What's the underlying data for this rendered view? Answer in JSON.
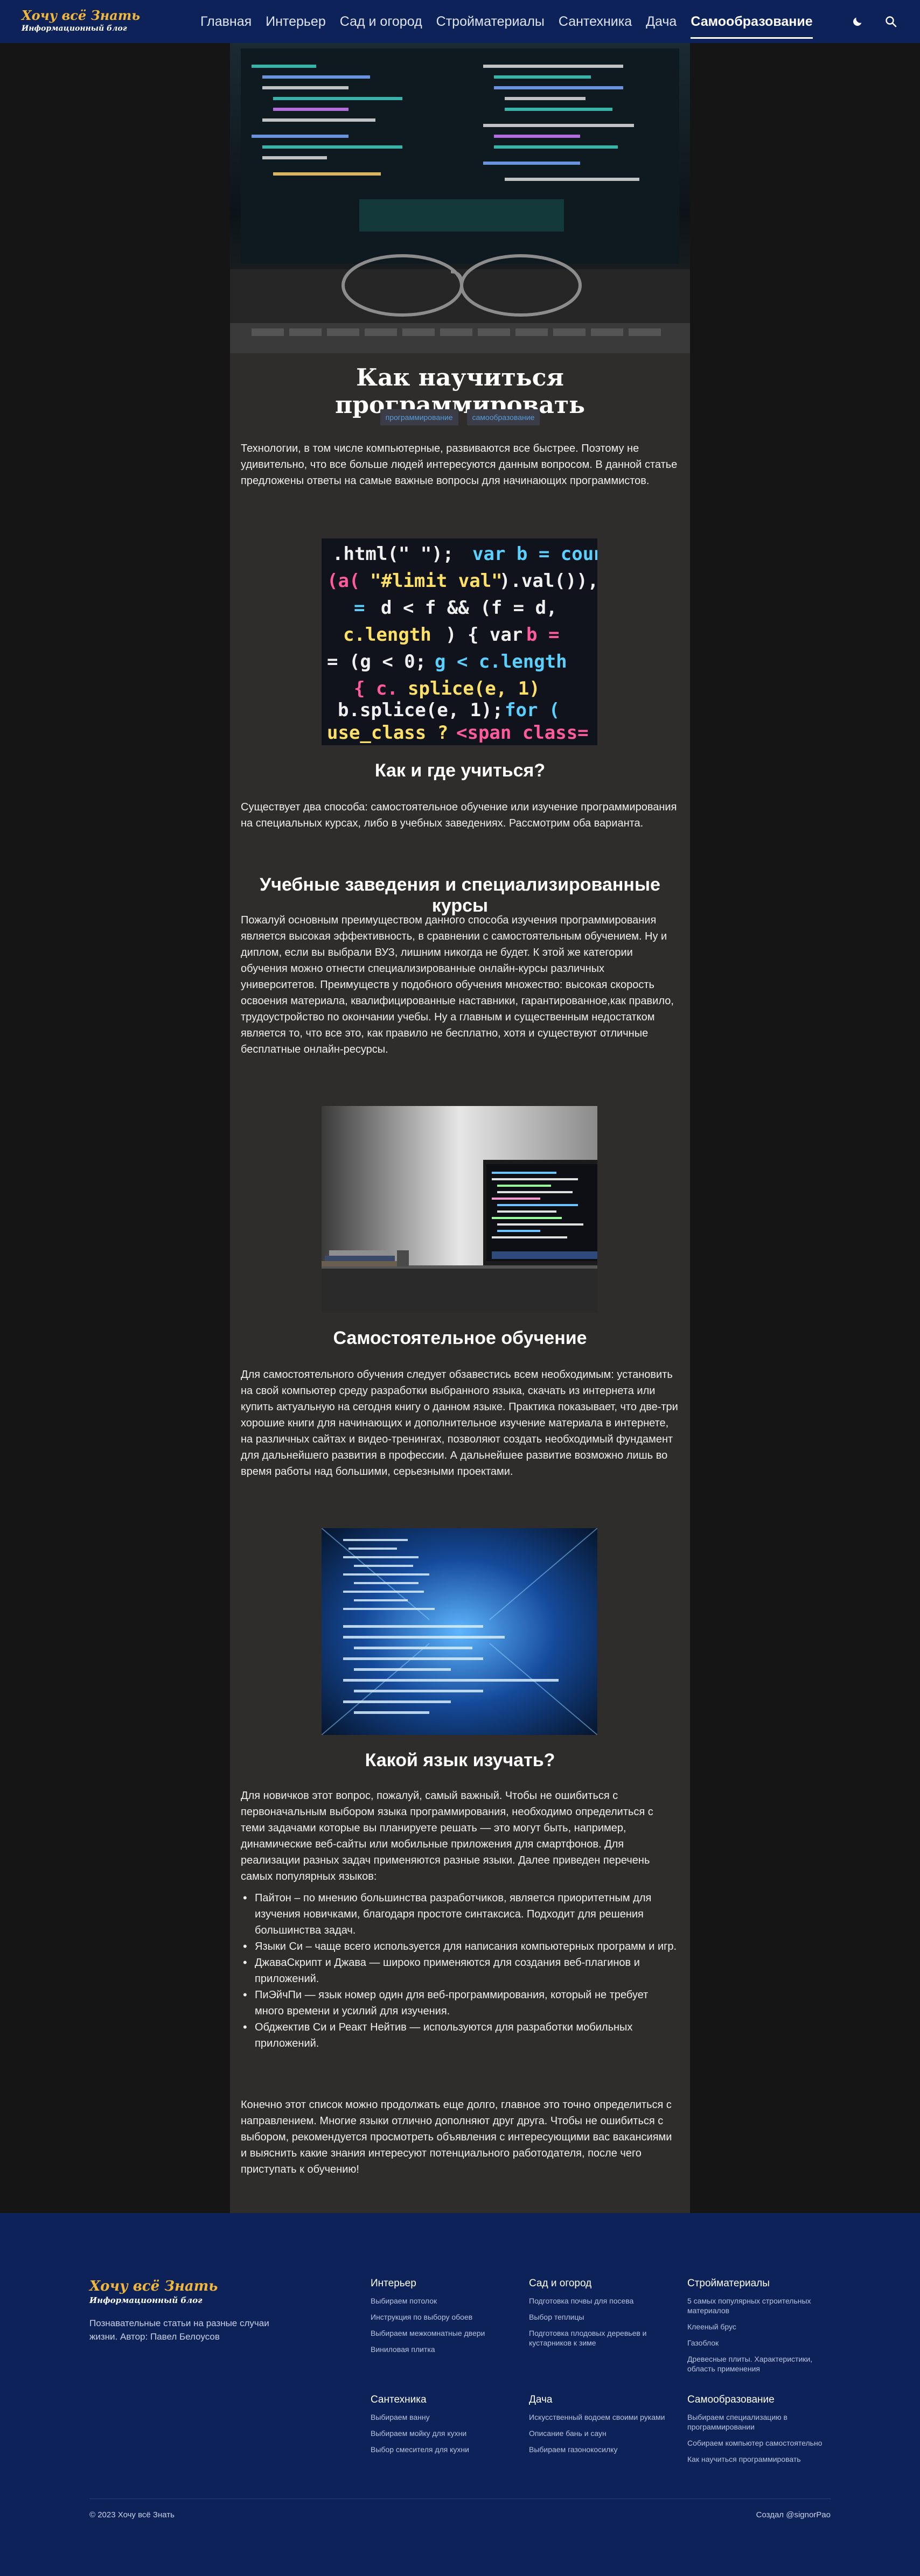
{
  "header": {
    "brand_title": "Хочу всё Знать",
    "brand_subtitle": "Информационный блог",
    "nav": [
      "Главная",
      "Интерьер",
      "Сад и огород",
      "Стройматериалы",
      "Сантехника",
      "Дача",
      "Самообразование"
    ],
    "active_nav_index": 6,
    "theme_icon": "moon-icon",
    "search_icon": "search-icon"
  },
  "article": {
    "title": "Как научиться программировать",
    "tags": [
      "программирование",
      "самообразование"
    ],
    "intro": "Технологии, в том числе компьютерные, развиваются все быстрее. Поэтому не удивительно, что все больше людей интересуются данным вопросом. В данной статье предложены ответы на самые важные вопросы для начинающих программистов.",
    "section1_title": "Как и где учиться?",
    "section1_text": "Существует два способа: самостоятельное обучение или изучение программирования на специальных курсах, либо в учебных заведениях. Рассмотрим оба варианта.",
    "section2_title": "Учебные заведения и специализированные курсы",
    "section2_text": "Пожалуй основным преимуществом данного способа изучения программирования является высокая эффективность, в сравнении с самостоятельным обучением. Ну и диплом, если вы выбрали ВУЗ, лишним никогда не будет. К этой же категории обучения можно отнести специализированные онлайн-курсы различных университетов. Преимуществ у подобного обучения множество: высокая скорость освоения материала, квалифицированные наставники, гарантированное,как правило, трудоустройство по окончании учебы. Ну а главным и существенным недостатком является то, что все это, как правило не бесплатно, хотя и существуют отличные бесплатные онлайн-ресурсы.",
    "section3_title": "Самостоятельное обучение",
    "section3_text": "Для самостоятельного обучения следует обзавестись всем необходимым: установить на свой компьютер среду разработки выбранного языка, скачать из интернета или купить актуальную на сегодня книгу о данном языке. Практика показывает, что две-три хорошие книги для начинающих и дополнительное изучение материала в интернете, на различных сайтах и видео-тренингах, позволяют создать необходимый фундамент для дальнейшего развития в профессии. А дальнейшее развитие возможно лишь во время работы над большими, серьезными проектами.",
    "section4_title": "Какой язык изучать?",
    "section4_text": "Для новичков этот вопрос, пожалуй, самый важный. Чтобы не ошибиться с первоначальным выбором языка программирования, необходимо определиться с теми задачами которые вы планируете решать — это могут быть, например, динамические веб-сайты или мобильные приложения для смартфонов. Для реализации разных задач применяются разные языки. Далее приведен перечень самых популярных языков:",
    "languages": [
      "Пайтон – по мнению большинства разработчиков, является приоритетным для изучения новичками, благодаря простоте синтаксиса. Подходит для решения большинства задач.",
      "Языки Си – чаще всего используется для написания компьютерных программ и игр.",
      "ДжаваСкрипт и Джава — широко применяются для создания веб-плагинов и приложений.",
      "ПиЭйчПи — язык номер один для веб-программирования, который не требует много времени и усилий для изучения.",
      "Обджектив Си и Реакт Нейтив — используются для разработки мобильных приложений."
    ],
    "conclusion": "Конечно этот список можно продолжать еще долго, главное это точно определиться с направлением. Многие языки отлично дополняют друг друга. Чтобы не ошибиться с выбором, рекомендуется просмотреть объявления с интересующими вас вакансиями и выяснить какие знания интересуют потенциального работодателя, после чего приступать к обучению!"
  },
  "footer": {
    "brand_title": "Хочу всё Знать",
    "brand_subtitle": "Информационный блог",
    "description": "Познавательные статьи на разные случаи жизни. Автор: Павел Белоусов",
    "columns": [
      {
        "title": "Интерьер",
        "links": [
          "Выбираем потолок",
          "Инструкция по выбору обоев",
          "Выбираем межкомнатные двери",
          "Виниловая плитка"
        ]
      },
      {
        "title": "Сад и огород",
        "links": [
          "Подготовка почвы для посева",
          "Выбор теплицы",
          "Подготовка плодовых деревьев и кустарников к зиме"
        ]
      },
      {
        "title": "Стройматериалы",
        "links": [
          "5 самых популярных строительных материалов",
          "Клееный брус",
          "Газоблок",
          "Древесные плиты. Характеристики, область применения"
        ]
      },
      {
        "title": "Сантехника",
        "links": [
          "Выбираем ванну",
          "Выбираем мойку для кухни",
          "Выбор смесителя для кухни"
        ]
      },
      {
        "title": "Дача",
        "links": [
          "Искусственный водоем своими руками",
          "Описание бань и саун",
          "Выбираем газонокосилку"
        ]
      },
      {
        "title": "Самообразование",
        "links": [
          "Выбираем специализацию в программировании",
          "Собираем компьютер самостоятельно",
          "Как научиться программировать"
        ]
      }
    ],
    "copyright": "© 2023 Хочу всё Знать",
    "credit": "Создал @signorPao"
  }
}
